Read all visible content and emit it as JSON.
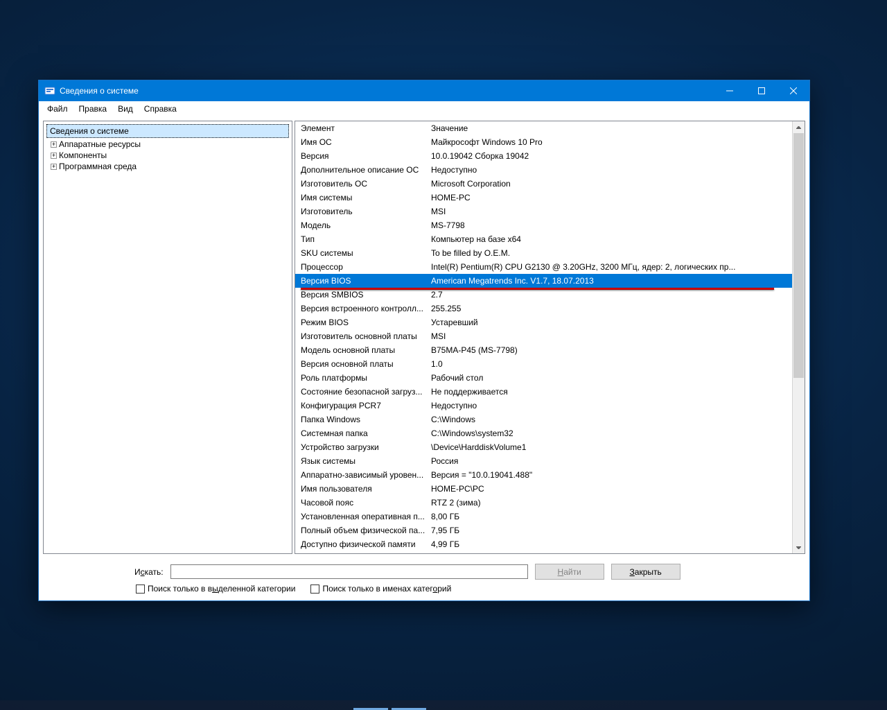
{
  "window": {
    "title": "Сведения о системе"
  },
  "menu": {
    "file": "Файл",
    "edit": "Правка",
    "view": "Вид",
    "help": "Справка"
  },
  "tree": {
    "root": "Сведения о системе",
    "hardware": "Аппаратные ресурсы",
    "components": "Компоненты",
    "software": "Программная среда"
  },
  "headers": {
    "element": "Элемент",
    "value": "Значение"
  },
  "rows": [
    {
      "k": "Имя ОС",
      "v": "Майкрософт Windows 10 Pro"
    },
    {
      "k": "Версия",
      "v": "10.0.19042 Сборка 19042"
    },
    {
      "k": "Дополнительное описание ОС",
      "v": "Недоступно"
    },
    {
      "k": "Изготовитель ОС",
      "v": "Microsoft Corporation"
    },
    {
      "k": "Имя системы",
      "v": "HOME-PC"
    },
    {
      "k": "Изготовитель",
      "v": "MSI"
    },
    {
      "k": "Модель",
      "v": "MS-7798"
    },
    {
      "k": "Тип",
      "v": "Компьютер на базе x64"
    },
    {
      "k": "SKU системы",
      "v": "To be filled by O.E.M."
    },
    {
      "k": "Процессор",
      "v": "Intel(R) Pentium(R) CPU G2130 @ 3.20GHz, 3200 МГц, ядер: 2, логических пр..."
    },
    {
      "k": "Версия BIOS",
      "v": "American Megatrends Inc. V1.7, 18.07.2013",
      "selected": true
    },
    {
      "k": "Версия SMBIOS",
      "v": "2.7"
    },
    {
      "k": "Версия встроенного контролл...",
      "v": "255.255"
    },
    {
      "k": "Режим BIOS",
      "v": "Устаревший"
    },
    {
      "k": "Изготовитель основной платы",
      "v": "MSI"
    },
    {
      "k": "Модель основной платы",
      "v": "B75MA-P45 (MS-7798)"
    },
    {
      "k": "Версия основной платы",
      "v": "1.0"
    },
    {
      "k": "Роль платформы",
      "v": "Рабочий стол"
    },
    {
      "k": "Состояние безопасной загруз...",
      "v": "Не поддерживается"
    },
    {
      "k": "Конфигурация PCR7",
      "v": "Недоступно"
    },
    {
      "k": "Папка Windows",
      "v": "C:\\Windows"
    },
    {
      "k": "Системная папка",
      "v": "C:\\Windows\\system32"
    },
    {
      "k": "Устройство загрузки",
      "v": "\\Device\\HarddiskVolume1"
    },
    {
      "k": "Язык системы",
      "v": "Россия"
    },
    {
      "k": "Аппаратно-зависимый уровен...",
      "v": "Версия = \"10.0.19041.488\""
    },
    {
      "k": "Имя пользователя",
      "v": "HOME-PC\\PC"
    },
    {
      "k": "Часовой пояс",
      "v": "RTZ 2 (зима)"
    },
    {
      "k": "Установленная оперативная п...",
      "v": "8,00 ГБ"
    },
    {
      "k": "Полный объем физической па...",
      "v": "7,95 ГБ"
    },
    {
      "k": "Доступно физической памяти",
      "v": "4,99 ГБ"
    }
  ],
  "search": {
    "label_prefix": "И",
    "label_under": "с",
    "label_suffix": "кать:",
    "find_prefix": "",
    "find_under": "Н",
    "find_suffix": "айти",
    "close_prefix": "",
    "close_under": "З",
    "close_suffix": "акрыть",
    "cat_prefix": "Поиск только в в",
    "cat_under": "ы",
    "cat_suffix": "деленной категории",
    "name_prefix": "Поиск только в именах катег",
    "name_under": "о",
    "name_suffix": "рий"
  }
}
